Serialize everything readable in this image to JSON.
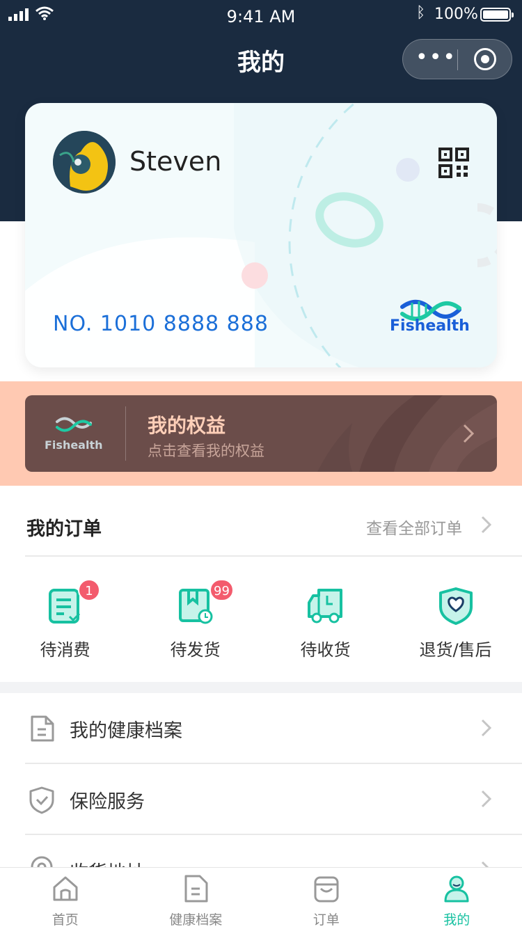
{
  "status_bar": {
    "time": "9:41 AM",
    "battery": "100%"
  },
  "header": {
    "title": "我的"
  },
  "member_card": {
    "name": "Steven",
    "number": "NO. 1010 8888 888",
    "brand": "Fishealth"
  },
  "benefits": {
    "brand": "Fishealth",
    "title": "我的权益",
    "subtitle": "点击查看我的权益"
  },
  "orders": {
    "title": "我的订单",
    "view_all": "查看全部订单",
    "items": [
      {
        "label": "待消费",
        "badge": "1",
        "icon": "receipt-icon"
      },
      {
        "label": "待发货",
        "badge": "99",
        "icon": "package-clock-icon"
      },
      {
        "label": "待收货",
        "badge": "",
        "icon": "truck-icon"
      },
      {
        "label": "退货/售后",
        "badge": "",
        "icon": "shield-heart-icon"
      }
    ]
  },
  "menu": [
    {
      "label": "我的健康档案",
      "icon": "document-icon"
    },
    {
      "label": "保险服务",
      "icon": "shield-check-icon"
    },
    {
      "label": "收货地址",
      "icon": "location-pin-icon"
    }
  ],
  "tab_bar": [
    {
      "label": "首页",
      "icon": "home-icon",
      "active": false
    },
    {
      "label": "健康档案",
      "icon": "document-icon",
      "active": false
    },
    {
      "label": "订单",
      "icon": "bag-icon",
      "active": false
    },
    {
      "label": "我的",
      "icon": "person-icon",
      "active": true
    }
  ],
  "colors": {
    "header_bg": "#1a2b40",
    "accent": "#17c1a1",
    "member_no": "#1b6fd8",
    "badge": "#f35b6d",
    "benefit_band": "#ffc9b2",
    "benefit_card": "#6b4d4a"
  }
}
